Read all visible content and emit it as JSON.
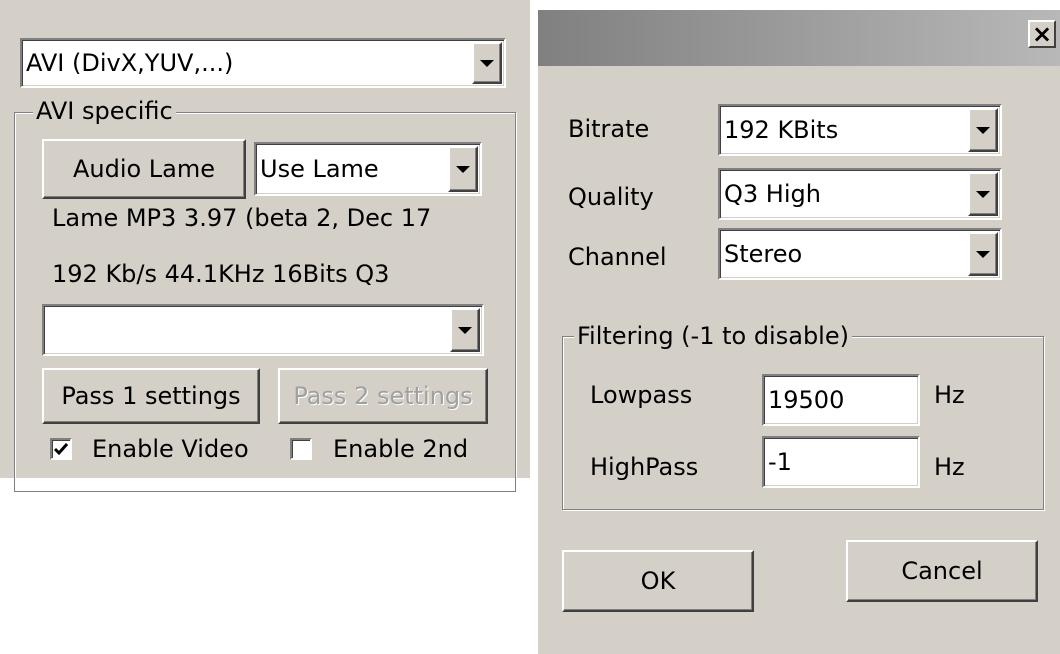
{
  "left_panel": {
    "container_combo": {
      "value": "AVI (DivX,YUV,...)"
    },
    "group_title": "AVI specific",
    "audio_button": "Audio Lame",
    "audio_mode_combo": {
      "value": "Use Lame"
    },
    "codec_info": "Lame MP3 3.97 (beta 2, Dec 17",
    "format_info": "192 Kb/s 44.1KHz 16Bits Q3",
    "empty_combo": {
      "value": ""
    },
    "pass1_button": "Pass 1 settings",
    "pass2_button": "Pass 2 settings",
    "enable_video": {
      "label": "Enable Video",
      "checked": true
    },
    "enable_2nd": {
      "label": "Enable 2nd",
      "checked": false
    }
  },
  "dialog": {
    "title": "",
    "close_glyph": "×",
    "bitrate": {
      "label": "Bitrate",
      "value": "192 KBits"
    },
    "quality": {
      "label": "Quality",
      "value": "Q3 High"
    },
    "channel": {
      "label": "Channel",
      "value": "Stereo"
    },
    "filtering": {
      "title": "Filtering (-1 to disable)",
      "lowpass": {
        "label": "Lowpass",
        "value": "19500",
        "unit": "Hz"
      },
      "highpass": {
        "label": "HighPass",
        "value": "-1",
        "unit": "Hz"
      }
    },
    "ok_button": "OK",
    "cancel_button": "Cancel"
  },
  "colors": {
    "dialog_face": "#d4d0c8",
    "title_gradient_start": "#808080",
    "title_gradient_end": "#b8b8b8"
  }
}
